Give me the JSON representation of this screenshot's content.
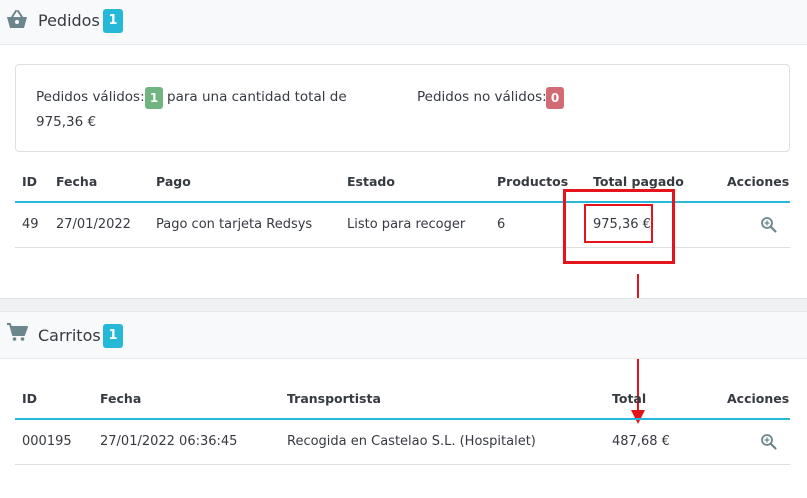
{
  "orders": {
    "title": "Pedidos",
    "count": "1",
    "summary": {
      "valid_label": "Pedidos válidos:",
      "valid_count": "1",
      "valid_suffix": "para una cantidad total de",
      "valid_total": "975,36 €",
      "invalid_label": "Pedidos no válidos:",
      "invalid_count": "0"
    },
    "columns": [
      "ID",
      "Fecha",
      "Pago",
      "Estado",
      "Productos",
      "Total pagado",
      "Acciones"
    ],
    "rows": [
      {
        "id": "49",
        "date": "27/01/2022",
        "payment": "Pago con tarjeta Redsys",
        "status": "Listo para recoger",
        "products": "6",
        "total": "975,36 €"
      }
    ]
  },
  "carts": {
    "title": "Carritos",
    "count": "1",
    "columns": [
      "ID",
      "Fecha",
      "Transportista",
      "Total",
      "Acciones"
    ],
    "rows": [
      {
        "id": "000195",
        "date": "27/01/2022 06:36:45",
        "carrier": "Recogida en Castelao S.L. (Hospitalet)",
        "total": "487,68 €"
      }
    ]
  },
  "icons": {
    "orders": "basket-icon",
    "carts": "shopping-cart-icon",
    "row_action": "zoom-icon"
  },
  "colors": {
    "accent": "#25b9d7",
    "success": "#70b580",
    "danger": "#d36b75",
    "annotation": "#e3141c"
  }
}
